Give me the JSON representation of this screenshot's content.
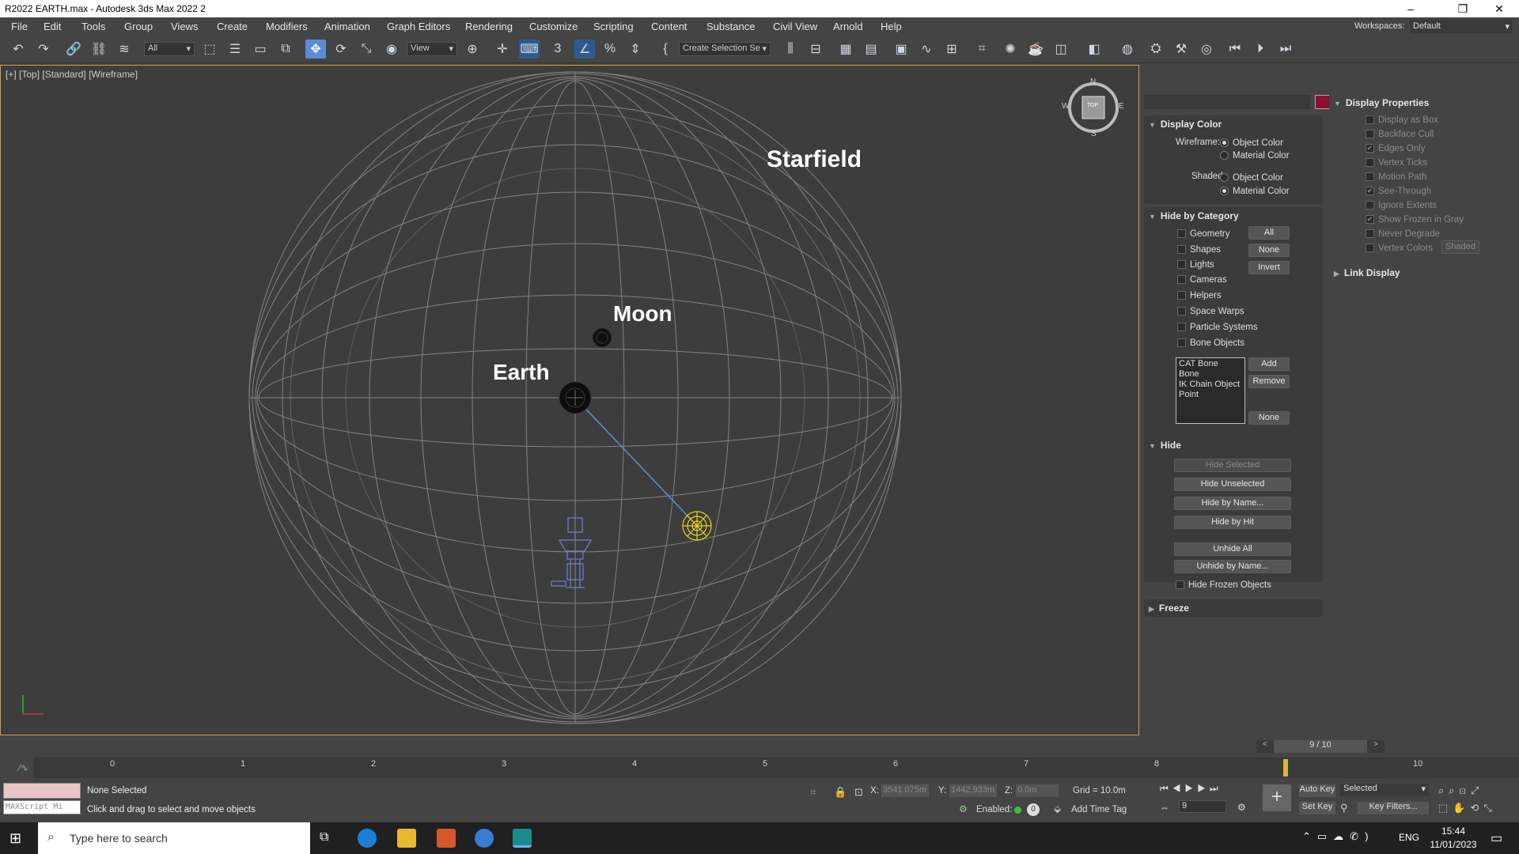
{
  "app": {
    "title": "R2022 EARTH.max - Autodesk 3ds Max 2022  2"
  },
  "menu": [
    "File",
    "Edit",
    "Tools",
    "Group",
    "Views",
    "Create",
    "Modifiers",
    "Animation",
    "Graph Editors",
    "Rendering",
    "Customize",
    "Scripting",
    "Content",
    "Substance",
    "Civil View",
    "Arnold",
    "Help"
  ],
  "workspace": {
    "label": "Workspaces:",
    "value": "Default"
  },
  "toolbar": {
    "filter": "All",
    "refcoord": "View",
    "selset": "Create Selection Se"
  },
  "viewport": {
    "label": "[+] [Top] [Standard] [Wireframe]",
    "objects": {
      "starfield": "Starfield",
      "moon": "Moon",
      "earth": "Earth"
    },
    "viewcube": {
      "top": "TOP",
      "n": "N",
      "s": "S",
      "e": "E",
      "w": "W"
    }
  },
  "command_panel": {
    "display_color": {
      "title": "Display Color",
      "wireframe_label": "Wireframe:",
      "shaded_label": "Shaded:",
      "object_color": "Object Color",
      "material_color": "Material Color",
      "wireframe_selected": "Object Color",
      "shaded_selected": "Material Color"
    },
    "hide_by_category": {
      "title": "Hide by Category",
      "items": [
        "Geometry",
        "Shapes",
        "Lights",
        "Cameras",
        "Helpers",
        "Space Warps",
        "Particle Systems",
        "Bone Objects"
      ],
      "buttons": {
        "all": "All",
        "none": "None",
        "invert": "Invert",
        "add": "Add",
        "remove": "Remove",
        "none2": "None"
      },
      "list": [
        "CAT Bone",
        "Bone",
        "IK Chain Object",
        "Point"
      ]
    },
    "hide": {
      "title": "Hide",
      "buttons": [
        "Hide Selected",
        "Hide Unselected",
        "Hide by Name...",
        "Hide by Hit",
        "Unhide All",
        "Unhide by Name..."
      ],
      "hide_frozen": "Hide Frozen Objects"
    },
    "freeze": {
      "title": "Freeze"
    },
    "display_properties": {
      "title": "Display Properties",
      "items": [
        {
          "label": "Display as Box",
          "checked": false
        },
        {
          "label": "Backface Cull",
          "checked": false
        },
        {
          "label": "Edges Only",
          "checked": true
        },
        {
          "label": "Vertex Ticks",
          "checked": false
        },
        {
          "label": "Motion Path",
          "checked": false
        },
        {
          "label": "See-Through",
          "checked": true
        },
        {
          "label": "Ignore Extents",
          "checked": false
        },
        {
          "label": "Show Frozen in Gray",
          "checked": true
        },
        {
          "label": "Never Degrade",
          "checked": false
        },
        {
          "label": "Vertex Colors",
          "checked": false
        }
      ],
      "shaded_btn": "Shaded"
    },
    "link_display": {
      "title": "Link Display"
    },
    "color_swatch": "#8b0f2e"
  },
  "timeline": {
    "frame": "9 / 10",
    "ticks": [
      "0",
      "1",
      "2",
      "3",
      "4",
      "5",
      "6",
      "7",
      "8",
      "9",
      "10"
    ]
  },
  "status": {
    "selection": "None Selected",
    "hint": "Click and drag to select and move objects",
    "maxscript": "MAXScript Mi",
    "x_label": "X:",
    "x": "3541.075m",
    "y_label": "Y:",
    "y": "1442.933m",
    "z_label": "Z:",
    "z": "0.0m",
    "grid": "Grid = 10.0m",
    "enabled": "Enabled:",
    "add_time_tag": "Add Time Tag",
    "auto_key": "Auto Key",
    "selected": "Selected",
    "set_key": "Set Key",
    "key_filters": "Key Filters...",
    "frame_field": "9"
  },
  "taskbar": {
    "search": "Type here to search",
    "lang": "ENG",
    "time": "15:44",
    "date": "11/01/2023"
  }
}
